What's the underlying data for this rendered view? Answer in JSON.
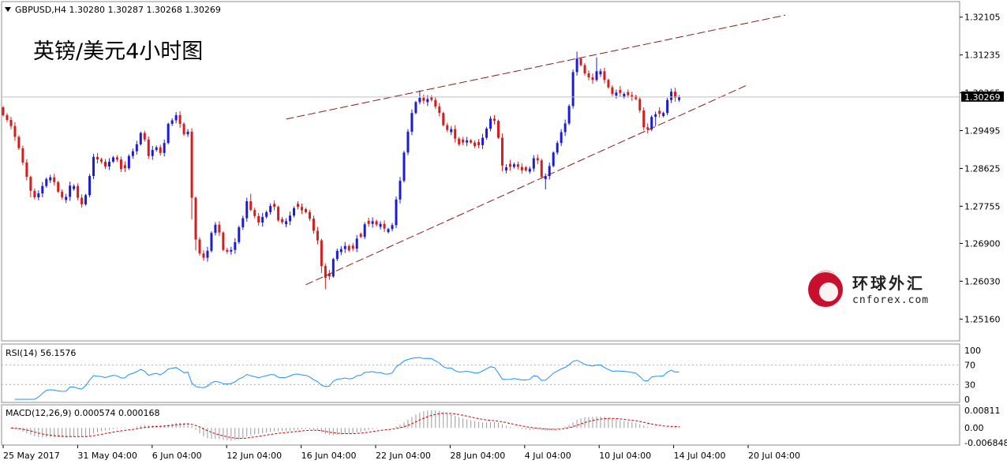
{
  "header": {
    "symbol_line": "GBPUSD,H4  1.30280 1.30287 1.30268 1.30269",
    "big_title": "英镑/美元4小时图"
  },
  "watermark": {
    "name": "环球外汇",
    "site": "cnforex.com",
    "colors": {
      "ball": "#c8102e",
      "ball_dark": "#7a0a18",
      "text": "#222222"
    }
  },
  "price_tag": "1.30269",
  "indicators": {
    "rsi_label": "RSI(14) 56.1576",
    "macd_label": "MACD(12,26,9) 0.000574 0.000168"
  },
  "colors": {
    "bull": "#1c1cd8",
    "bear": "#d81c1c",
    "channel": "#8b1a1a",
    "rsi_line": "#1e90ff",
    "macd_hist": "#9a9a9a",
    "macd_signal": "#d00000",
    "grid_border": "#8c8c8c"
  },
  "chart_data": [
    {
      "type": "candlestick",
      "symbol": "GBPUSD",
      "timeframe": "H4",
      "ohlc_last": {
        "open": 1.3028,
        "high": 1.30287,
        "low": 1.30268,
        "close": 1.30269
      },
      "y_ticks": [
        "1.32105",
        "1.31235",
        "1.30365",
        "1.29495",
        "1.28625",
        "1.27755",
        "1.26900",
        "1.26030",
        "1.25160"
      ],
      "ylim": [
        1.2473,
        1.3239
      ],
      "x_ticks": [
        "25 May 2017",
        "31 May 04:00",
        "6 Jun 04:00",
        "12 Jun 04:00",
        "16 Jun 04:00",
        "22 Jun 04:00",
        "28 Jun 04:00",
        "4 Jul 04:00",
        "10 Jul 04:00",
        "14 Jul 04:00",
        "20 Jul 04:00"
      ],
      "channel_lines": [
        {
          "name": "upper",
          "from": {
            "bar": 72,
            "price": 1.2976
          },
          "to": {
            "bar": 199,
            "price": 1.3215
          }
        },
        {
          "name": "lower",
          "from": {
            "bar": 77,
            "price": 1.2595
          },
          "to": {
            "bar": 189,
            "price": 1.3053
          }
        }
      ],
      "closes": [
        1.2985,
        1.2974,
        1.296,
        1.2935,
        1.2909,
        1.2876,
        1.2843,
        1.2811,
        1.2796,
        1.2805,
        1.2822,
        1.2838,
        1.2842,
        1.2831,
        1.2809,
        1.2796,
        1.2797,
        1.2823,
        1.2822,
        1.2795,
        1.278,
        1.2801,
        1.2845,
        1.2889,
        1.2883,
        1.2878,
        1.2867,
        1.2878,
        1.2888,
        1.2883,
        1.2861,
        1.2863,
        1.2891,
        1.2902,
        1.2918,
        1.2944,
        1.2929,
        1.2891,
        1.2905,
        1.2911,
        1.2898,
        1.2921,
        1.2965,
        1.2973,
        1.2985,
        1.2965,
        1.2941,
        1.2947,
        1.2795,
        1.2699,
        1.2667,
        1.2657,
        1.2673,
        1.2714,
        1.2733,
        1.2715,
        1.2675,
        1.2671,
        1.2675,
        1.2693,
        1.2727,
        1.2748,
        1.2787,
        1.2767,
        1.2753,
        1.2738,
        1.2751,
        1.2762,
        1.2776,
        1.2774,
        1.2743,
        1.2739,
        1.2741,
        1.2754,
        1.2771,
        1.2774,
        1.2766,
        1.2762,
        1.2747,
        1.2719,
        1.2697,
        1.2638,
        1.2611,
        1.2614,
        1.2654,
        1.2673,
        1.2677,
        1.2684,
        1.2674,
        1.2678,
        1.2701,
        1.2705,
        1.2734,
        1.2735,
        1.2741,
        1.2733,
        1.2735,
        1.2724,
        1.2723,
        1.2732,
        1.2791,
        1.2834,
        1.2899,
        1.2947,
        1.299,
        1.3015,
        1.3025,
        1.3018,
        1.3022,
        1.302,
        1.3005,
        1.299,
        1.2962,
        1.2951,
        1.2953,
        1.2931,
        1.2918,
        1.2922,
        1.2927,
        1.2922,
        1.2914,
        1.2916,
        1.2933,
        1.2954,
        1.2977,
        1.2972,
        1.2933,
        1.2869,
        1.2865,
        1.2866,
        1.2872,
        1.2866,
        1.2858,
        1.2858,
        1.2862,
        1.2886,
        1.2881,
        1.2843,
        1.2845,
        1.2868,
        1.2899,
        1.2921,
        1.2946,
        1.2966,
        1.3006,
        1.3084,
        1.3115,
        1.31,
        1.3081,
        1.3072,
        1.3066,
        1.3086,
        1.3086,
        1.3066,
        1.3049,
        1.3034,
        1.3037,
        1.3036,
        1.3034,
        1.3031,
        1.3026,
        1.3022,
        1.2996,
        1.2957,
        1.2952,
        1.2981,
        1.2987,
        1.2988,
        1.299,
        1.302,
        1.3039,
        1.3025,
        1.3027
      ]
    },
    {
      "type": "line",
      "name": "RSI(14)",
      "last_value": 56.1576,
      "y_ticks": [
        "100",
        "70",
        "30",
        "0"
      ],
      "ylim": [
        0,
        100
      ]
    },
    {
      "type": "bar+line",
      "name": "MACD(12,26,9)",
      "main_last": 0.000574,
      "signal_last": 0.000168,
      "y_ticks": [
        "0.00811",
        "0.00",
        "-0.006848"
      ],
      "ylim": [
        -0.006848,
        0.00811
      ]
    }
  ]
}
